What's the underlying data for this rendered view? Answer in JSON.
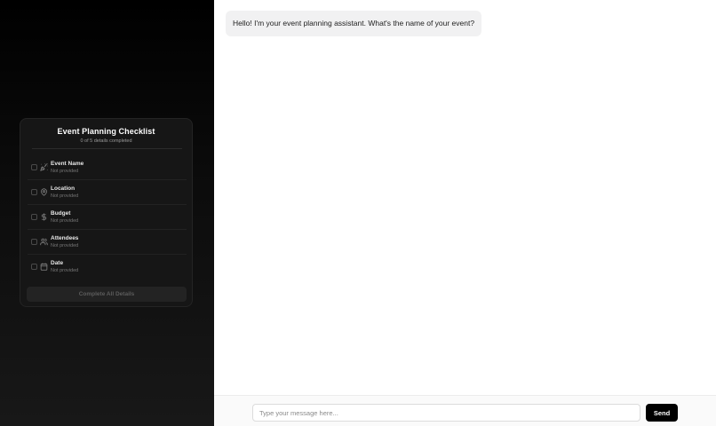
{
  "checklist": {
    "title": "Event Planning Checklist",
    "progress_text": "0 of 5 details completed",
    "items": [
      {
        "label": "Event Name",
        "status": "Not provided",
        "icon": "party-popper-icon",
        "checked": false
      },
      {
        "label": "Location",
        "status": "Not provided",
        "icon": "map-pin-icon",
        "checked": false
      },
      {
        "label": "Budget",
        "status": "Not provided",
        "icon": "dollar-sign-icon",
        "checked": false
      },
      {
        "label": "Attendees",
        "status": "Not provided",
        "icon": "users-icon",
        "checked": false
      },
      {
        "label": "Date",
        "status": "Not provided",
        "icon": "calendar-icon",
        "checked": false
      }
    ],
    "complete_button_label": "Complete All Details"
  },
  "chat": {
    "messages": [
      {
        "role": "assistant",
        "text": "Hello! I'm your event planning assistant. What's the name of your event?"
      }
    ],
    "input_placeholder": "Type your message here...",
    "input_value": "",
    "send_label": "Send"
  },
  "colors": {
    "sidebar_background": "#000000",
    "card_background": "#161616",
    "send_button": "#000000",
    "assistant_bubble": "#f1f1f2"
  }
}
